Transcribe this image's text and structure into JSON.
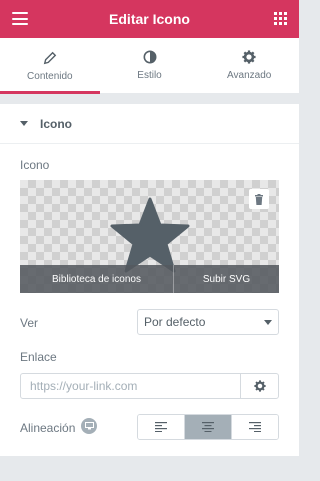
{
  "header": {
    "title": "Editar Icono"
  },
  "tabs": [
    {
      "label": "Contenido",
      "icon": "pencil-icon",
      "active": true
    },
    {
      "label": "Estilo",
      "icon": "contrast-icon",
      "active": false
    },
    {
      "label": "Avanzado",
      "icon": "gear-icon",
      "active": false
    }
  ],
  "section": {
    "title": "Icono"
  },
  "icon_field": {
    "label": "Icono",
    "preview_icon": "star-icon",
    "library_label": "Biblioteca de iconos",
    "upload_label": "Subir SVG"
  },
  "view_field": {
    "label": "Ver",
    "value": "Por defecto"
  },
  "link_field": {
    "label": "Enlace",
    "placeholder": "https://your-link.com",
    "value": ""
  },
  "alignment_field": {
    "label": "Alineación",
    "options": [
      "align-left",
      "align-center",
      "align-right"
    ],
    "selected": "align-center"
  },
  "colors": {
    "accent": "#d5365f",
    "text": "#6d7882",
    "dark": "#556068",
    "muted": "#a4afb7"
  }
}
